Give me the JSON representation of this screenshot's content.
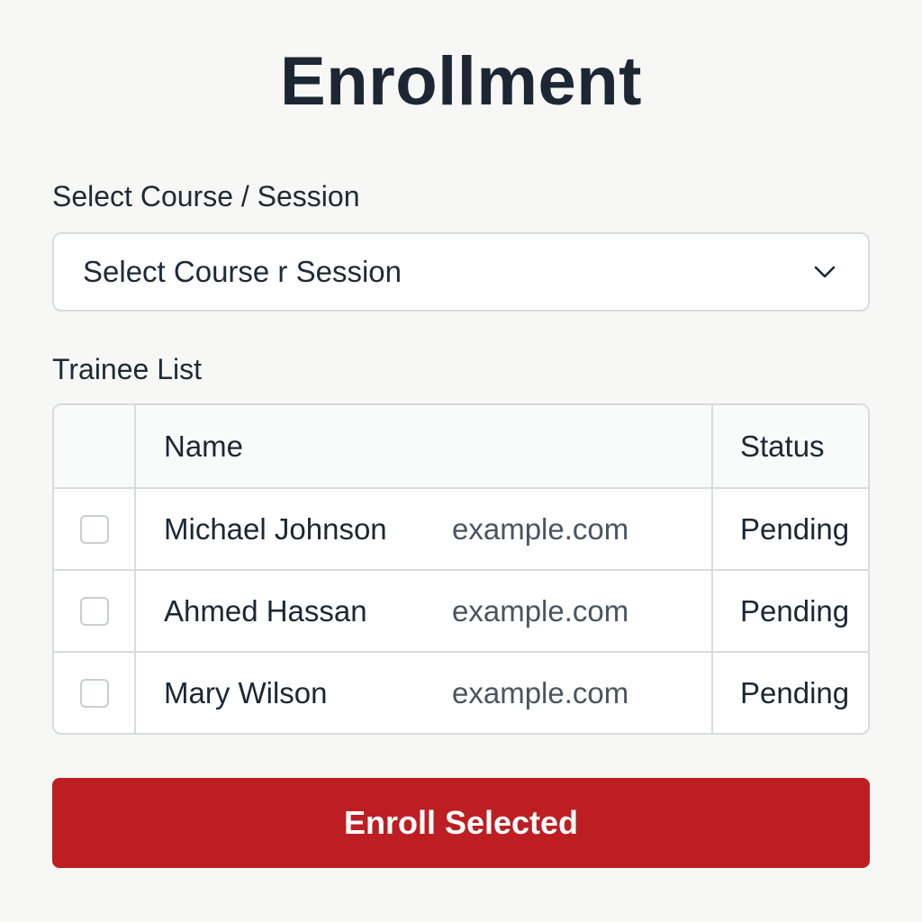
{
  "page": {
    "title": "Enrollment"
  },
  "course_select": {
    "label": "Select Course / Session",
    "selected_value": "Select Course r Session",
    "icon": "chevron-down-icon"
  },
  "trainee_list": {
    "label": "Trainee List",
    "columns": {
      "name": "Name",
      "status": "Status"
    },
    "rows": [
      {
        "name": "Michael Johnson",
        "email": "example.com",
        "status": "Pending",
        "checked": false
      },
      {
        "name": "Ahmed Hassan",
        "email": "example.com",
        "status": "Pending",
        "checked": false
      },
      {
        "name": "Mary Wilson",
        "email": "example.com",
        "status": "Pending",
        "checked": false
      }
    ]
  },
  "actions": {
    "enroll_label": "Enroll Selected"
  },
  "colors": {
    "accent": "#bd1e22",
    "text": "#1c2733",
    "border": "#d8dbdf",
    "background": "#f7f7f5"
  }
}
